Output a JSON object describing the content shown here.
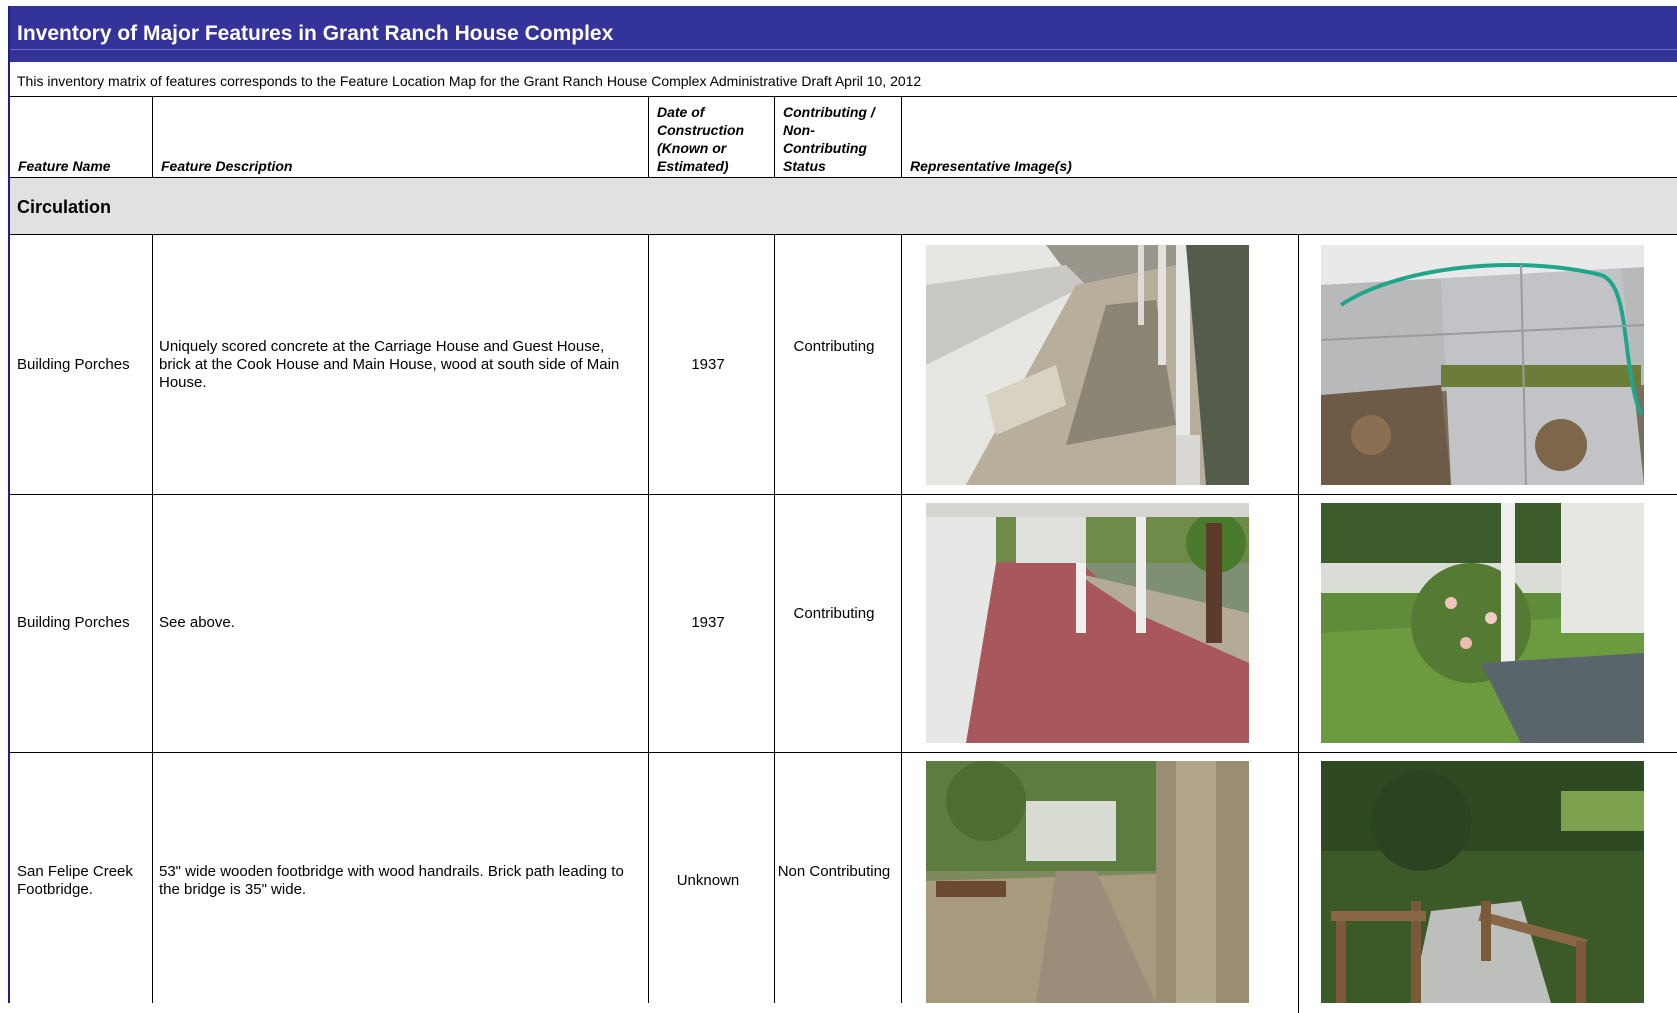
{
  "header": {
    "title": "Inventory of Major Features in Grant Ranch House Complex",
    "subtitle": "This inventory matrix of features corresponds to the Feature Location Map for the Grant Ranch House Complex  Administrative Draft April 10, 2012",
    "accent_color": "#333399"
  },
  "columns": {
    "feature_name": "Feature Name",
    "feature_description": "Feature Description",
    "date": "Date of Construction (Known or Estimated)",
    "status": "Contributing / Non-Contributing Status",
    "images": "Representative Image(s)"
  },
  "section": {
    "title": "Circulation"
  },
  "rows": [
    {
      "name": "Building Porches",
      "description": "Uniquely scored concrete at the Carriage House and Guest House, brick at the Cook House and Main House, wood at south side of Main House.",
      "date": "1937",
      "status": "Contributing",
      "images": [
        "wooden-porch-photo",
        "concrete-paving-photo"
      ]
    },
    {
      "name": "Building Porches",
      "description": "See above.",
      "date": "1937",
      "status": "Contributing",
      "images": [
        "brick-porch-photo",
        "porch-garden-photo"
      ]
    },
    {
      "name": "San Felipe Creek Footbridge.",
      "description": "53\" wide wooden footbridge with wood handrails.  Brick path leading to the bridge is 35\" wide.",
      "date": "Unknown",
      "status": "Non Contributing",
      "images": [
        "brick-path-photo",
        "footbridge-photo"
      ]
    }
  ]
}
